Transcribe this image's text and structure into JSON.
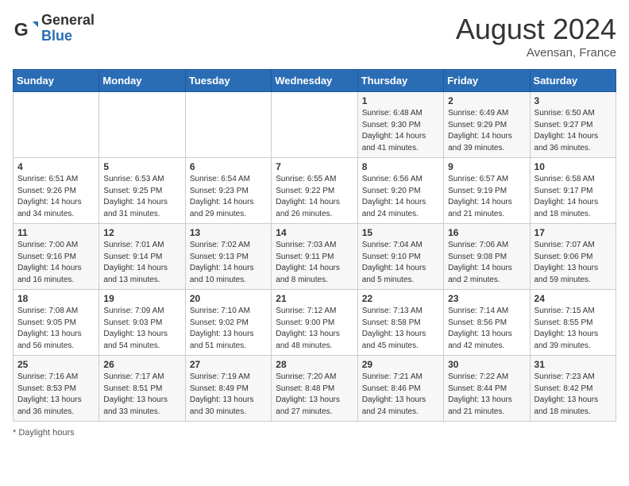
{
  "header": {
    "logo_general": "General",
    "logo_blue": "Blue",
    "month_title": "August 2024",
    "location": "Avensan, France"
  },
  "days_of_week": [
    "Sunday",
    "Monday",
    "Tuesday",
    "Wednesday",
    "Thursday",
    "Friday",
    "Saturday"
  ],
  "footer": {
    "daylight_note": "Daylight hours"
  },
  "weeks": [
    [
      {
        "day": "",
        "info": ""
      },
      {
        "day": "",
        "info": ""
      },
      {
        "day": "",
        "info": ""
      },
      {
        "day": "",
        "info": ""
      },
      {
        "day": "1",
        "info": "Sunrise: 6:48 AM\nSunset: 9:30 PM\nDaylight: 14 hours\nand 41 minutes."
      },
      {
        "day": "2",
        "info": "Sunrise: 6:49 AM\nSunset: 9:29 PM\nDaylight: 14 hours\nand 39 minutes."
      },
      {
        "day": "3",
        "info": "Sunrise: 6:50 AM\nSunset: 9:27 PM\nDaylight: 14 hours\nand 36 minutes."
      }
    ],
    [
      {
        "day": "4",
        "info": "Sunrise: 6:51 AM\nSunset: 9:26 PM\nDaylight: 14 hours\nand 34 minutes."
      },
      {
        "day": "5",
        "info": "Sunrise: 6:53 AM\nSunset: 9:25 PM\nDaylight: 14 hours\nand 31 minutes."
      },
      {
        "day": "6",
        "info": "Sunrise: 6:54 AM\nSunset: 9:23 PM\nDaylight: 14 hours\nand 29 minutes."
      },
      {
        "day": "7",
        "info": "Sunrise: 6:55 AM\nSunset: 9:22 PM\nDaylight: 14 hours\nand 26 minutes."
      },
      {
        "day": "8",
        "info": "Sunrise: 6:56 AM\nSunset: 9:20 PM\nDaylight: 14 hours\nand 24 minutes."
      },
      {
        "day": "9",
        "info": "Sunrise: 6:57 AM\nSunset: 9:19 PM\nDaylight: 14 hours\nand 21 minutes."
      },
      {
        "day": "10",
        "info": "Sunrise: 6:58 AM\nSunset: 9:17 PM\nDaylight: 14 hours\nand 18 minutes."
      }
    ],
    [
      {
        "day": "11",
        "info": "Sunrise: 7:00 AM\nSunset: 9:16 PM\nDaylight: 14 hours\nand 16 minutes."
      },
      {
        "day": "12",
        "info": "Sunrise: 7:01 AM\nSunset: 9:14 PM\nDaylight: 14 hours\nand 13 minutes."
      },
      {
        "day": "13",
        "info": "Sunrise: 7:02 AM\nSunset: 9:13 PM\nDaylight: 14 hours\nand 10 minutes."
      },
      {
        "day": "14",
        "info": "Sunrise: 7:03 AM\nSunset: 9:11 PM\nDaylight: 14 hours\nand 8 minutes."
      },
      {
        "day": "15",
        "info": "Sunrise: 7:04 AM\nSunset: 9:10 PM\nDaylight: 14 hours\nand 5 minutes."
      },
      {
        "day": "16",
        "info": "Sunrise: 7:06 AM\nSunset: 9:08 PM\nDaylight: 14 hours\nand 2 minutes."
      },
      {
        "day": "17",
        "info": "Sunrise: 7:07 AM\nSunset: 9:06 PM\nDaylight: 13 hours\nand 59 minutes."
      }
    ],
    [
      {
        "day": "18",
        "info": "Sunrise: 7:08 AM\nSunset: 9:05 PM\nDaylight: 13 hours\nand 56 minutes."
      },
      {
        "day": "19",
        "info": "Sunrise: 7:09 AM\nSunset: 9:03 PM\nDaylight: 13 hours\nand 54 minutes."
      },
      {
        "day": "20",
        "info": "Sunrise: 7:10 AM\nSunset: 9:02 PM\nDaylight: 13 hours\nand 51 minutes."
      },
      {
        "day": "21",
        "info": "Sunrise: 7:12 AM\nSunset: 9:00 PM\nDaylight: 13 hours\nand 48 minutes."
      },
      {
        "day": "22",
        "info": "Sunrise: 7:13 AM\nSunset: 8:58 PM\nDaylight: 13 hours\nand 45 minutes."
      },
      {
        "day": "23",
        "info": "Sunrise: 7:14 AM\nSunset: 8:56 PM\nDaylight: 13 hours\nand 42 minutes."
      },
      {
        "day": "24",
        "info": "Sunrise: 7:15 AM\nSunset: 8:55 PM\nDaylight: 13 hours\nand 39 minutes."
      }
    ],
    [
      {
        "day": "25",
        "info": "Sunrise: 7:16 AM\nSunset: 8:53 PM\nDaylight: 13 hours\nand 36 minutes."
      },
      {
        "day": "26",
        "info": "Sunrise: 7:17 AM\nSunset: 8:51 PM\nDaylight: 13 hours\nand 33 minutes."
      },
      {
        "day": "27",
        "info": "Sunrise: 7:19 AM\nSunset: 8:49 PM\nDaylight: 13 hours\nand 30 minutes."
      },
      {
        "day": "28",
        "info": "Sunrise: 7:20 AM\nSunset: 8:48 PM\nDaylight: 13 hours\nand 27 minutes."
      },
      {
        "day": "29",
        "info": "Sunrise: 7:21 AM\nSunset: 8:46 PM\nDaylight: 13 hours\nand 24 minutes."
      },
      {
        "day": "30",
        "info": "Sunrise: 7:22 AM\nSunset: 8:44 PM\nDaylight: 13 hours\nand 21 minutes."
      },
      {
        "day": "31",
        "info": "Sunrise: 7:23 AM\nSunset: 8:42 PM\nDaylight: 13 hours\nand 18 minutes."
      }
    ]
  ]
}
